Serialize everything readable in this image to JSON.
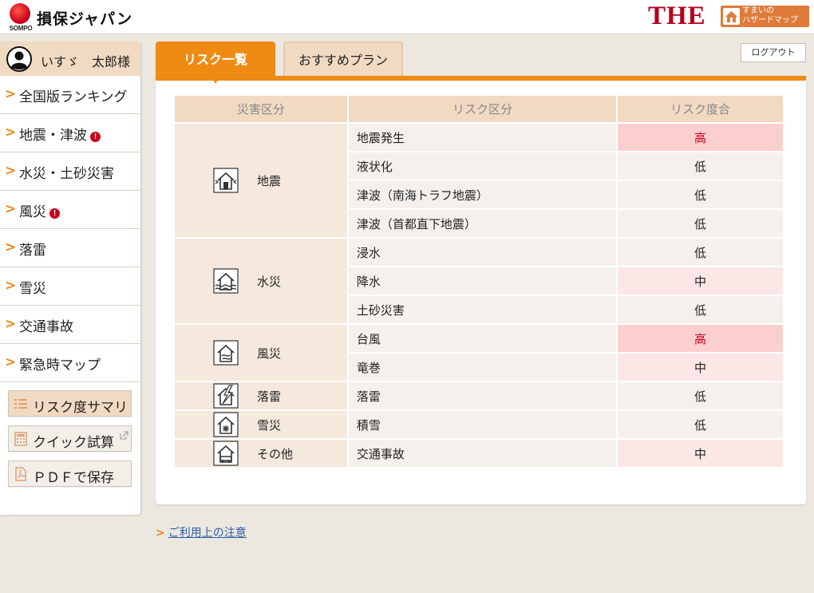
{
  "header": {
    "logo_sub": "SOMPO",
    "brand": "損保ジャパン",
    "the_logo": "THE",
    "hazard_badge": "すまいの\nハザードマップ",
    "icons": {
      "logo": "sompo-logo",
      "hazard": "house-icon"
    }
  },
  "sidebar": {
    "user_name": "いすゞ　太郎様",
    "nav": [
      {
        "label": "全国版ランキング",
        "alert": false
      },
      {
        "label": "地震・津波",
        "alert": true
      },
      {
        "label": "水災・土砂災害",
        "alert": false
      },
      {
        "label": "風災",
        "alert": true
      },
      {
        "label": "落雷",
        "alert": false
      },
      {
        "label": "雪災",
        "alert": false
      },
      {
        "label": "交通事故",
        "alert": false
      },
      {
        "label": "緊急時マップ",
        "alert": false
      }
    ],
    "alert_mark": "!",
    "tools": [
      {
        "label": "リスク度サマリ",
        "icon": "list-icon"
      },
      {
        "label": "クイック試算",
        "icon": "calculator-icon"
      },
      {
        "label": "ＰＤＦで保存",
        "icon": "pdf-icon"
      }
    ]
  },
  "tabs": {
    "active": "リスク一覧",
    "inactive": "おすすめプラン"
  },
  "logout": "ログアウト",
  "table": {
    "headers": [
      "災害区分",
      "リスク区分",
      "リスク度合"
    ],
    "groups": [
      {
        "category": "地震",
        "icon": "earthquake-house-icon",
        "rows": [
          {
            "risk": "地震発生",
            "level": "高",
            "severity": "high"
          },
          {
            "risk": "液状化",
            "level": "低",
            "severity": "low"
          },
          {
            "risk": "津波（南海トラフ地震）",
            "level": "低",
            "severity": "low"
          },
          {
            "risk": "津波（首都直下地震）",
            "level": "低",
            "severity": "low"
          }
        ]
      },
      {
        "category": "水災",
        "icon": "flood-house-icon",
        "rows": [
          {
            "risk": "浸水",
            "level": "低",
            "severity": "low"
          },
          {
            "risk": "降水",
            "level": "中",
            "severity": "mid"
          },
          {
            "risk": "土砂災害",
            "level": "低",
            "severity": "low"
          }
        ]
      },
      {
        "category": "風災",
        "icon": "wind-house-icon",
        "rows": [
          {
            "risk": "台風",
            "level": "高",
            "severity": "high"
          },
          {
            "risk": "竜巻",
            "level": "中",
            "severity": "mid"
          }
        ]
      },
      {
        "category": "落雷",
        "icon": "lightning-house-icon",
        "rows": [
          {
            "risk": "落雷",
            "level": "低",
            "severity": "low"
          }
        ]
      },
      {
        "category": "雪災",
        "icon": "snow-house-icon",
        "rows": [
          {
            "risk": "積雪",
            "level": "低",
            "severity": "low"
          }
        ]
      },
      {
        "category": "その他",
        "icon": "accident-house-icon",
        "rows": [
          {
            "risk": "交通事故",
            "level": "中",
            "severity": "mid"
          }
        ]
      }
    ]
  },
  "footer": {
    "notice": "ご利用上の注意"
  },
  "colors": {
    "accent": "#ef8a13",
    "brand_red": "#c8001c",
    "high_bg": "#fccfcf",
    "mid_bg": "#fce6e6"
  }
}
